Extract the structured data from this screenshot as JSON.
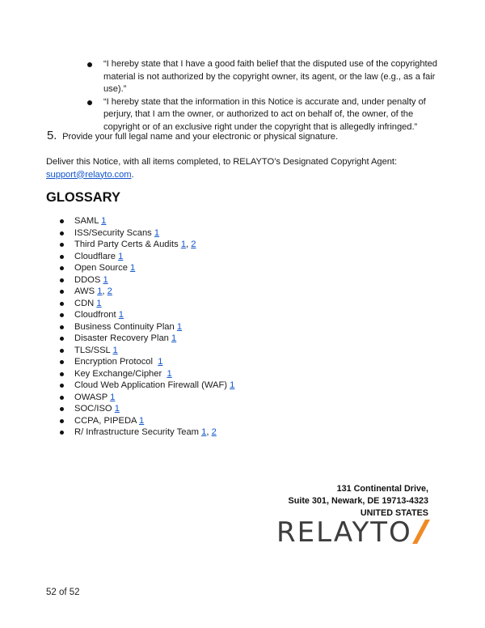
{
  "notice": {
    "bullets": [
      {
        "text": "“I hereby state that I have a good faith belief that the disputed use of the copyrighted material is not authorized by the copyright owner, its agent, or the law (e.g., as a fair use).”"
      },
      {
        "text": "“I hereby state that the information in this Notice is accurate and, under penalty of perjury, that I am the owner, or authorized to act on behalf of, the owner, of the copyright or of an exclusive right under the copyright that is allegedly infringed.”"
      }
    ],
    "item5": {
      "number": "5.",
      "text": "Provide your full legal name and your electronic or physical signature."
    },
    "deliver_text": "Deliver this Notice, with all items completed, to RELAYTO’s Designated Copyright Agent: ",
    "deliver_email": "support@relayto.com",
    "deliver_end": "."
  },
  "glossary": {
    "title": "GLOSSARY",
    "items": [
      {
        "term": "SAML",
        "sep": " ",
        "refs": [
          "1"
        ]
      },
      {
        "term": "ISS/Security Scans",
        "sep": " ",
        "refs": [
          "1"
        ]
      },
      {
        "term": "Third Party Certs & Audits",
        "sep": " ",
        "refs": [
          "1",
          "2"
        ]
      },
      {
        "term": "Cloudflare",
        "sep": " ",
        "refs": [
          "1"
        ]
      },
      {
        "term": "Open Source",
        "sep": " ",
        "refs": [
          "1"
        ]
      },
      {
        "term": "DDOS",
        "sep": " ",
        "refs": [
          "1"
        ]
      },
      {
        "term": "AWS",
        "sep": " ",
        "refs": [
          "1",
          "2"
        ]
      },
      {
        "term": "CDN",
        "sep": " ",
        "refs": [
          "1"
        ]
      },
      {
        "term": "Cloudfront",
        "sep": " ",
        "refs": [
          "1"
        ]
      },
      {
        "term": "Business Continuity Plan",
        "sep": " ",
        "refs": [
          "1"
        ]
      },
      {
        "term": "Disaster Recovery Plan",
        "sep": " ",
        "refs": [
          "1"
        ]
      },
      {
        "term": "TLS/SSL",
        "sep": " ",
        "refs": [
          "1"
        ]
      },
      {
        "term": "Encryption Protocol",
        "sep": "  ",
        "refs": [
          "1"
        ]
      },
      {
        "term": "Key Exchange/Cipher",
        "sep": "  ",
        "refs": [
          "1"
        ]
      },
      {
        "term": "Cloud Web Application Firewall (WAF)",
        "sep": " ",
        "refs": [
          "1"
        ]
      },
      {
        "term": "OWASP",
        "sep": " ",
        "refs": [
          "1"
        ]
      },
      {
        "term": "SOC/ISO",
        "sep": " ",
        "refs": [
          "1"
        ]
      },
      {
        "term": "CCPA, PIPEDA",
        "sep": " ",
        "refs": [
          "1"
        ]
      },
      {
        "term": "R/ Infrastructure Security Team",
        "sep": " ",
        "refs": [
          "1",
          "2"
        ]
      }
    ]
  },
  "footer": {
    "address_line1": "131 Continental Drive,",
    "address_line2": "Suite 301, Newark, DE 19713-4323",
    "address_line3": "UNITED STATES",
    "logo_text": "RELAYTO",
    "logo_accent_color": "#f08a24",
    "page_number": "52 of 52"
  },
  "colors": {
    "link": "#1155cc",
    "text": "#1a1a1a"
  }
}
